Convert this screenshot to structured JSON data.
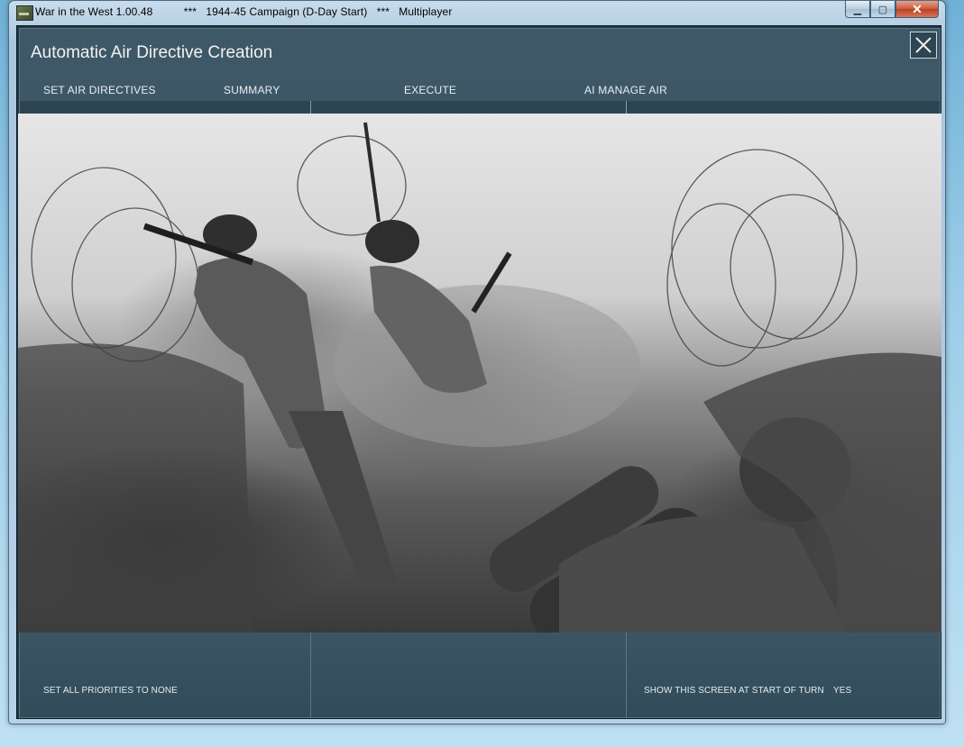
{
  "window": {
    "title": "War in the West 1.00.48          ***   1944-45 Campaign (D-Day Start)   ***   Multiplayer",
    "minimize_symbol": "▁",
    "maximize_symbol": "▢",
    "close_symbol": "✕"
  },
  "dialog": {
    "title": "Automatic Air Directive Creation"
  },
  "tabs": [
    {
      "label": "SET AIR DIRECTIVES"
    },
    {
      "label": "SUMMARY"
    },
    {
      "label": "EXECUTE"
    },
    {
      "label": "AI MANAGE AIR"
    }
  ],
  "footer": {
    "set_all_priorities": "SET ALL PRIORITIES TO NONE",
    "show_screen_label": "SHOW THIS SCREEN AT START OF TURN",
    "show_screen_value": "YES"
  },
  "icons": {
    "app": "app-icon",
    "close": "close-icon"
  },
  "colors": {
    "panel": "#3f5868",
    "text": "#e8eef2"
  }
}
